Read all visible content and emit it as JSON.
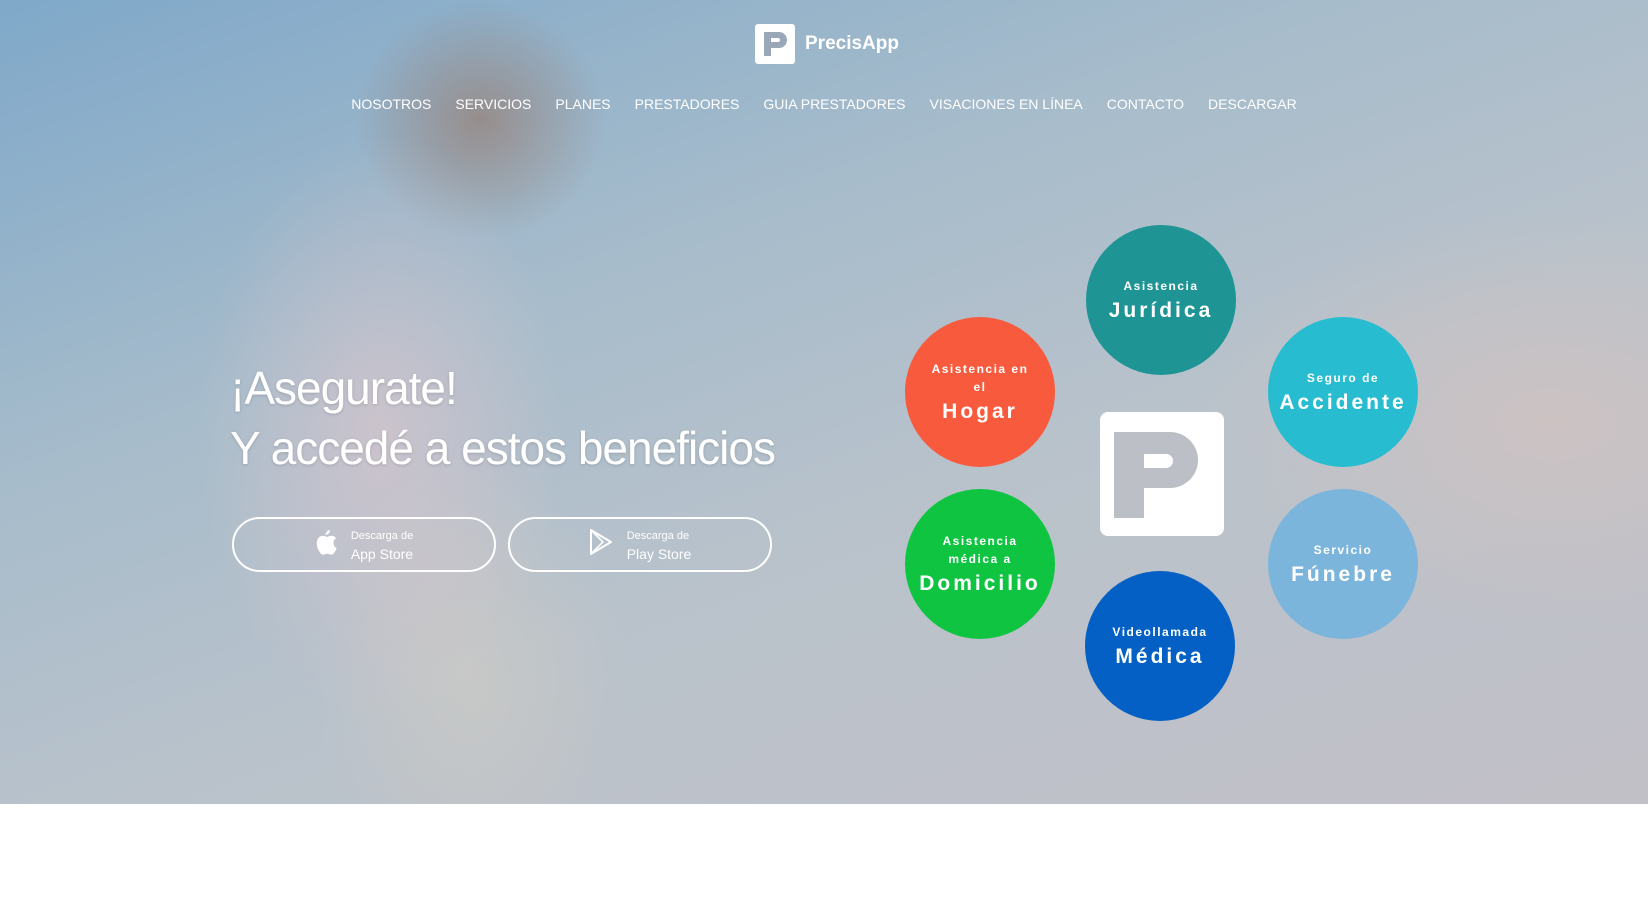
{
  "brand": {
    "name": "PrecisApp"
  },
  "nav": {
    "items": [
      "NOSOTROS",
      "SERVICIOS",
      "PLANES",
      "PRESTADORES",
      "GUIA PRESTADORES",
      "VISACIONES EN LÍNEA",
      "CONTACTO",
      "DESCARGAR"
    ]
  },
  "hero": {
    "headline_line1": "¡Asegurate!",
    "headline_line2": "Y accedé a estos beneficios"
  },
  "app_store": {
    "small": "Descarga de",
    "big": "App Store",
    "icon": "apple-icon"
  },
  "play_store": {
    "small": "Descarga de",
    "big": "Play Store",
    "icon": "play-store-icon"
  },
  "services": [
    {
      "pre": "Asistencia",
      "main": "Jurídica",
      "color": "#1e9494"
    },
    {
      "pre": "Asistencia en el",
      "main": "Hogar",
      "color": "#f85a3e"
    },
    {
      "pre": "Seguro de",
      "main": "Accidente",
      "color": "#27bcd0"
    },
    {
      "pre": "Asistencia médica a",
      "main": "Domicilio",
      "color": "#0fc440"
    },
    {
      "pre": "Servicio",
      "main": "Fúnebre",
      "color": "#7cb5dc"
    },
    {
      "pre": "Videollamada",
      "main": "Médica",
      "color": "#0460c4"
    }
  ],
  "colors": {
    "brand_white": "#ffffff"
  }
}
